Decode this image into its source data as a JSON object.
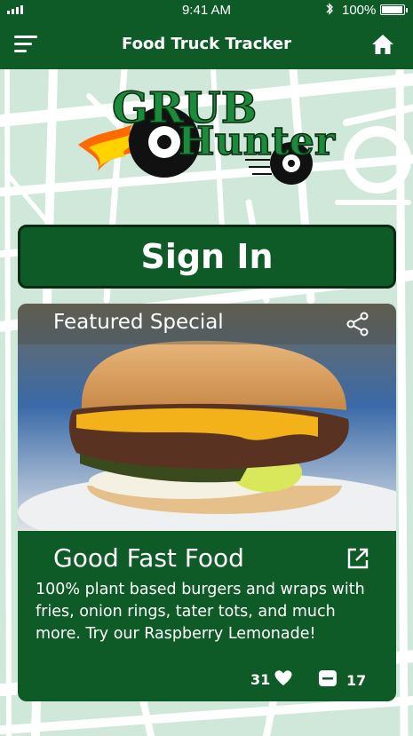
{
  "status_bar": {
    "time": "9:41 AM",
    "battery_text": "100%",
    "battery_level": 1.0,
    "icons": [
      "signal-icon",
      "bluetooth-icon",
      "battery-icon"
    ]
  },
  "header": {
    "title": "Food Truck Tracker",
    "icons": [
      "menu-icon",
      "home-icon"
    ]
  },
  "logo": {
    "line1": "GRUB",
    "line2": "Hunter"
  },
  "signin": {
    "label": "Sign In"
  },
  "featured": {
    "title": "Featured Special",
    "name": "Good Fast Food",
    "description": "100% plant based burgers and wraps with fries, onion rings, tater tots, and much more.  Try our Raspberry Lemonade!",
    "likes": "31",
    "comments": "17",
    "icons": [
      "share-icon",
      "external-link-icon",
      "heart-icon",
      "comment-icon"
    ]
  },
  "colors": {
    "primary": "#0e5b28",
    "map_bg": "#cfe8d9",
    "map_roads": "#ffffff",
    "border_dark": "#0b2a14"
  }
}
